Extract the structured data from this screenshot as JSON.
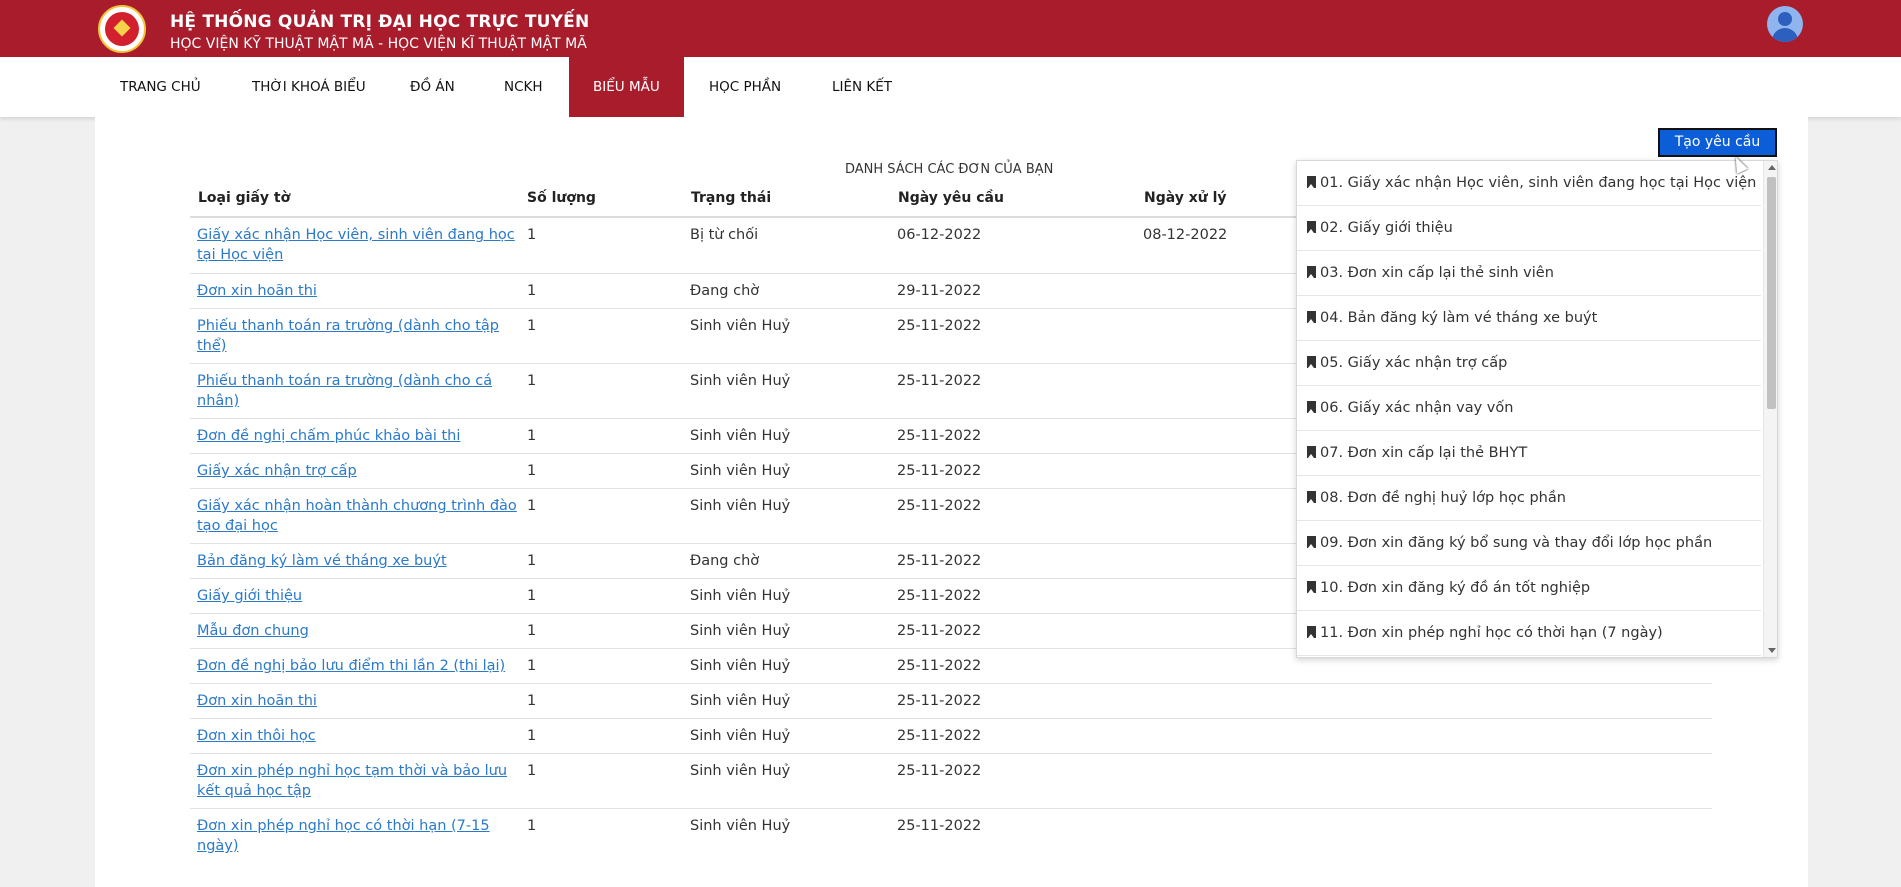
{
  "header": {
    "title": "HỆ THỐNG QUẢN TRỊ ĐẠI HỌC TRỰC TUYẾN",
    "subtitle": "HỌC VIỆN KỸ THUẬT MẬT MÃ - HỌC VIỆN KĨ THUẬT MẬT MÃ"
  },
  "nav": {
    "items": [
      {
        "label": "TRANG CHỦ"
      },
      {
        "label": "THỜI KHOÁ BIỂU"
      },
      {
        "label": "ĐỒ ÁN"
      },
      {
        "label": "NCKH"
      },
      {
        "label": "BIỂU MẪU"
      },
      {
        "label": "HỌC PHẦN"
      },
      {
        "label": "LIÊN KẾT"
      }
    ],
    "active": "BIỂU MẪU"
  },
  "create_button": {
    "label": "Tạo yêu cầu"
  },
  "table": {
    "title": "DANH SÁCH CÁC ĐƠN CỦA BẠN",
    "columns": [
      "Loại giấy tờ",
      "Số lượng",
      "Trạng thái",
      "Ngày yêu cầu",
      "Ngày xử lý"
    ],
    "rows": [
      {
        "type": "Giấy xác nhận Học viên, sinh viên đang học tại Học viện",
        "qty": "1",
        "status": "Bị từ chối",
        "requested": "06-12-2022",
        "processed": "08-12-2022"
      },
      {
        "type": "Đơn xin hoãn thi",
        "qty": "1",
        "status": "Đang chờ",
        "requested": "29-11-2022",
        "processed": ""
      },
      {
        "type": "Phiếu thanh toán ra trường (dành cho tập thể)",
        "qty": "1",
        "status": "Sinh viên Huỷ",
        "requested": "25-11-2022",
        "processed": ""
      },
      {
        "type": "Phiếu thanh toán ra trường (dành cho cá nhân)",
        "qty": "1",
        "status": "Sinh viên Huỷ",
        "requested": "25-11-2022",
        "processed": ""
      },
      {
        "type": "Đơn đề nghị chấm phúc khảo bài thi",
        "qty": "1",
        "status": "Sinh viên Huỷ",
        "requested": "25-11-2022",
        "processed": ""
      },
      {
        "type": "Giấy xác nhận trợ cấp",
        "qty": "1",
        "status": "Sinh viên Huỷ",
        "requested": "25-11-2022",
        "processed": ""
      },
      {
        "type": "Giấy xác nhận hoàn thành chương trình đào tạo đại học",
        "qty": "1",
        "status": "Sinh viên Huỷ",
        "requested": "25-11-2022",
        "processed": ""
      },
      {
        "type": "Bản đăng ký làm vé tháng xe buýt",
        "qty": "1",
        "status": "Đang chờ",
        "requested": "25-11-2022",
        "processed": ""
      },
      {
        "type": "Giấy giới thiệu",
        "qty": "1",
        "status": "Sinh viên Huỷ",
        "requested": "25-11-2022",
        "processed": ""
      },
      {
        "type": "Mẫu đơn chung",
        "qty": "1",
        "status": "Sinh viên Huỷ",
        "requested": "25-11-2022",
        "processed": ""
      },
      {
        "type": "Đơn đề nghị bảo lưu điểm thi lần 2 (thi lại)",
        "qty": "1",
        "status": "Sinh viên Huỷ",
        "requested": "25-11-2022",
        "processed": ""
      },
      {
        "type": "Đơn xin hoãn thi",
        "qty": "1",
        "status": "Sinh viên Huỷ",
        "requested": "25-11-2022",
        "processed": ""
      },
      {
        "type": "Đơn xin thôi học",
        "qty": "1",
        "status": "Sinh viên Huỷ",
        "requested": "25-11-2022",
        "processed": ""
      },
      {
        "type": "Đơn xin phép nghỉ học tạm thời và bảo lưu kết quả học tập",
        "qty": "1",
        "status": "Sinh viên Huỷ",
        "requested": "25-11-2022",
        "processed": ""
      },
      {
        "type": "Đơn xin phép nghỉ học có thời hạn (7-15 ngày)",
        "qty": "1",
        "status": "Sinh viên Huỷ",
        "requested": "25-11-2022",
        "processed": ""
      }
    ]
  },
  "dropdown": {
    "items": [
      "01. Giấy xác nhận Học viên, sinh viên đang học tại Học viện",
      "02. Giấy giới thiệu",
      "03. Đơn xin cấp lại thẻ sinh viên",
      "04. Bản đăng ký làm vé tháng xe buýt",
      "05. Giấy xác nhận trợ cấp",
      "06. Giấy xác nhận vay vốn",
      "07. Đơn xin cấp lại thẻ BHYT",
      "08. Đơn đề nghị huỷ lớp học phần",
      "09. Đơn xin đăng ký bổ sung và thay đổi lớp học phần",
      "10. Đơn xin đăng ký đồ án tốt nghiệp",
      "11. Đơn xin phép nghỉ học có thời hạn (7 ngày)"
    ]
  },
  "colors": {
    "brand": "#a81c2c",
    "link": "#2b79c9",
    "button": "#0b5ed7"
  }
}
